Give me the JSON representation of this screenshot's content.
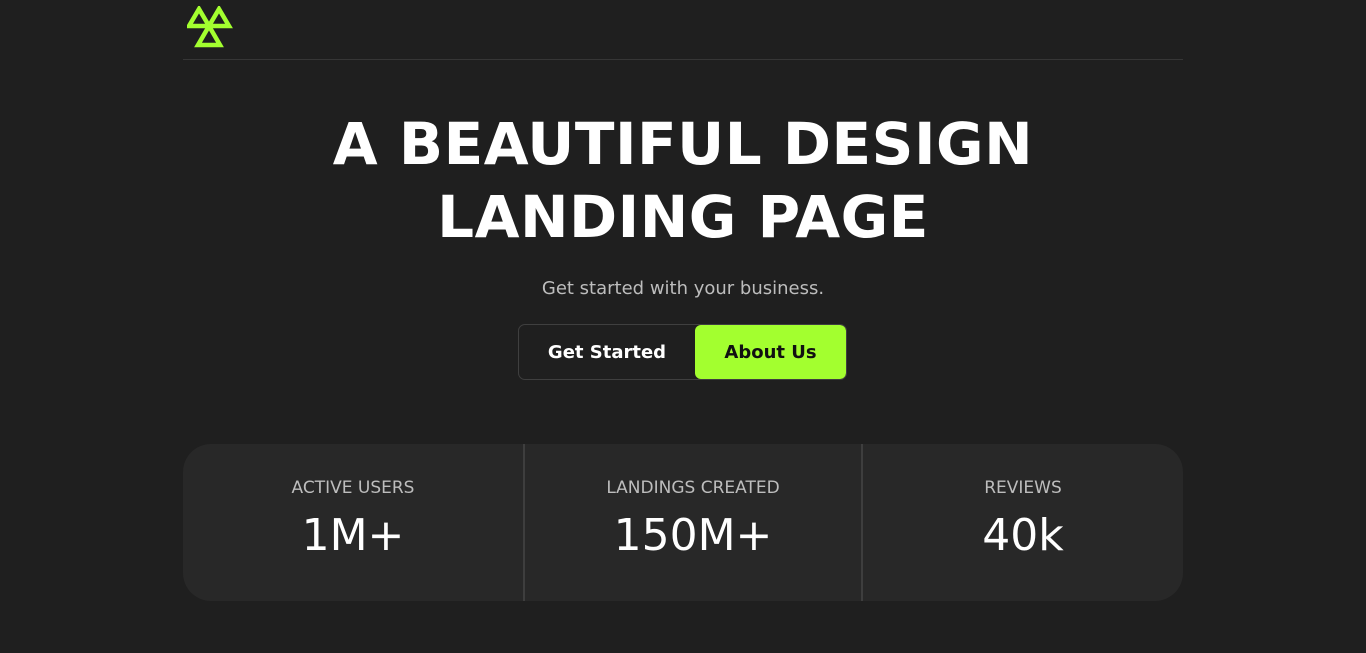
{
  "brand": {
    "logo_icon": "triangle-logo-icon",
    "accent_color": "#a3ff2f"
  },
  "hero": {
    "title_line1": "A BEAUTIFUL DESIGN",
    "title_line2": "LANDING PAGE",
    "subtitle": "Get started with your business."
  },
  "actions": {
    "get_started_label": "Get Started",
    "about_label": "About Us"
  },
  "stats": [
    {
      "label": "ACTIVE USERS",
      "value": "1M+"
    },
    {
      "label": "LANDINGS CREATED",
      "value": "150M+"
    },
    {
      "label": "REVIEWS",
      "value": "40k"
    }
  ]
}
